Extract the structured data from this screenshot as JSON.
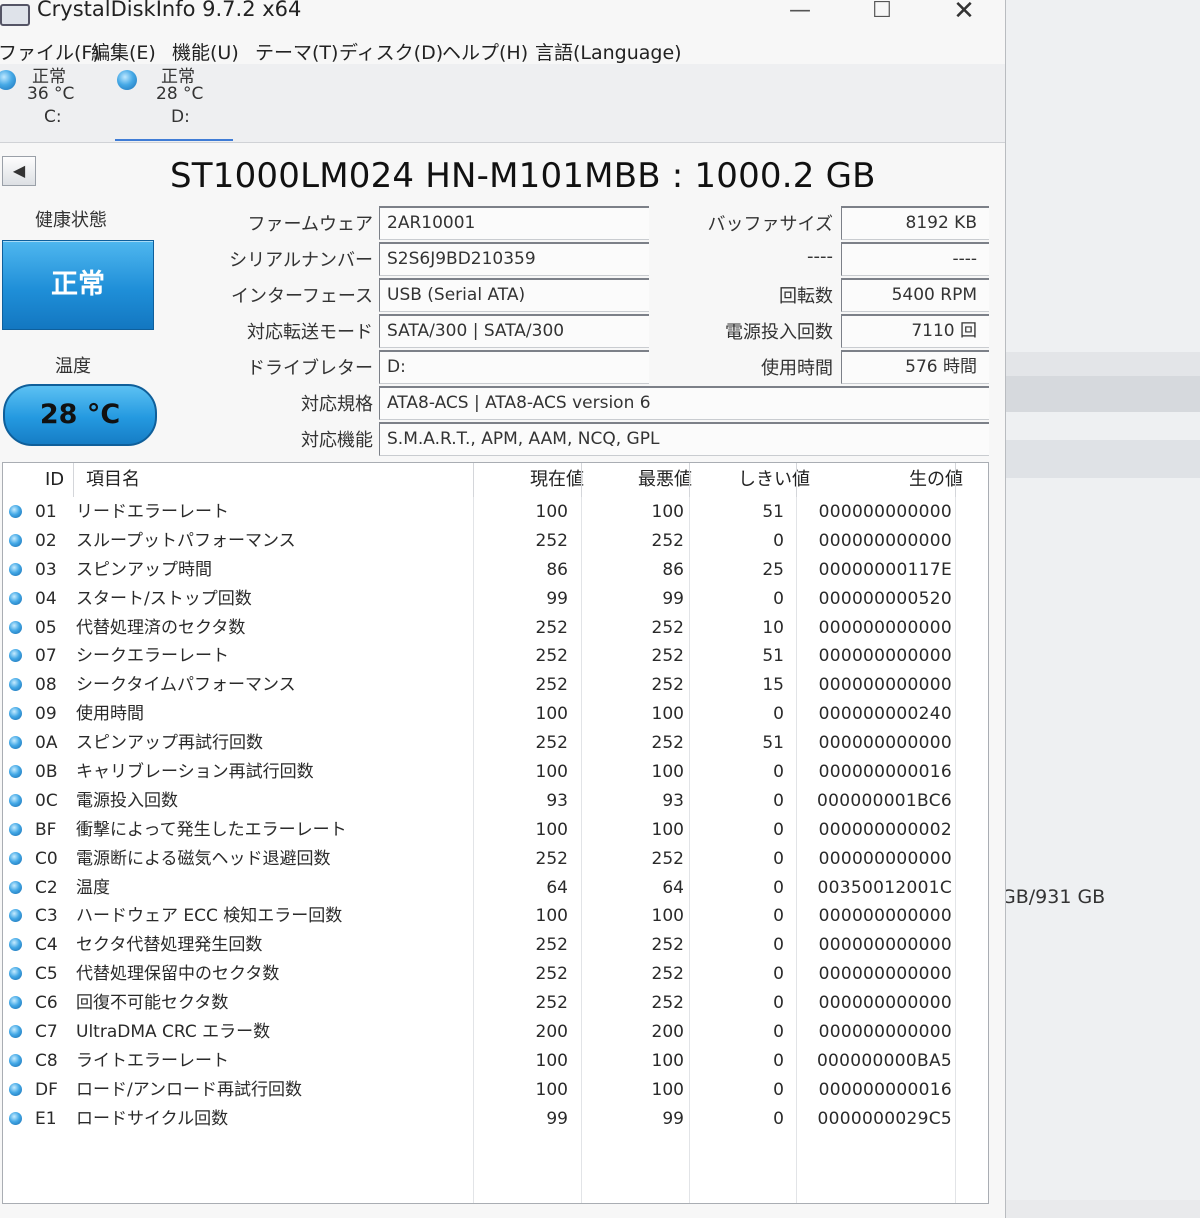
{
  "window": {
    "title": "CrystalDiskInfo 9.7.2 x64",
    "minimize": "—",
    "maximize": "☐",
    "close": "✕"
  },
  "menu": [
    "ファイル(F)",
    "編集(E)",
    "機能(U)",
    "テーマ(T)",
    "ディスク(D)",
    "ヘルプ(H)",
    "言語(Language)"
  ],
  "drives": [
    {
      "status": "正常",
      "temp": "36 °C",
      "letter": "C:"
    },
    {
      "status": "正常",
      "temp": "28 °C",
      "letter": "D:"
    }
  ],
  "disk": {
    "model": "ST1000LM024 HN-M101MBB : 1000.2 GB",
    "health_label": "健康状態",
    "health_value": "正常",
    "temp_label": "温度",
    "temp_value": "28 °C",
    "firmware_label": "ファームウェア",
    "firmware": "2AR10001",
    "serial_label": "シリアルナンバー",
    "serial": "S2S6J9BD210359",
    "interface_label": "インターフェース",
    "interface": "USB (Serial ATA)",
    "transfer_label": "対応転送モード",
    "transfer": "SATA/300 | SATA/300",
    "letter_label": "ドライブレター",
    "letter": "D:",
    "standard_label": "対応規格",
    "standard": "ATA8-ACS | ATA8-ACS version 6",
    "features_label": "対応機能",
    "features": "S.M.A.R.T., APM, AAM, NCQ, GPL",
    "buffer_label": "バッファサイズ",
    "buffer": "8192 KB",
    "blank_label": "----",
    "blank_value": "----",
    "rpm_label": "回転数",
    "rpm": "5400 RPM",
    "power_count_label": "電源投入回数",
    "power_count": "7110 回",
    "hours_label": "使用時間",
    "hours": "576 時間"
  },
  "background": {
    "volume": "GB/931 GB"
  },
  "table": {
    "headers": {
      "id": "ID",
      "name": "項目名",
      "current": "現在値",
      "worst": "最悪値",
      "threshold": "しきい値",
      "raw": "生の値"
    },
    "rows": [
      {
        "id": "01",
        "name": "リードエラーレート",
        "current": "100",
        "worst": "100",
        "threshold": "51",
        "raw": "000000000000"
      },
      {
        "id": "02",
        "name": "スループットパフォーマンス",
        "current": "252",
        "worst": "252",
        "threshold": "0",
        "raw": "000000000000"
      },
      {
        "id": "03",
        "name": "スピンアップ時間",
        "current": "86",
        "worst": "86",
        "threshold": "25",
        "raw": "00000000117E"
      },
      {
        "id": "04",
        "name": "スタート/ストップ回数",
        "current": "99",
        "worst": "99",
        "threshold": "0",
        "raw": "000000000520"
      },
      {
        "id": "05",
        "name": "代替処理済のセクタ数",
        "current": "252",
        "worst": "252",
        "threshold": "10",
        "raw": "000000000000"
      },
      {
        "id": "07",
        "name": "シークエラーレート",
        "current": "252",
        "worst": "252",
        "threshold": "51",
        "raw": "000000000000"
      },
      {
        "id": "08",
        "name": "シークタイムパフォーマンス",
        "current": "252",
        "worst": "252",
        "threshold": "15",
        "raw": "000000000000"
      },
      {
        "id": "09",
        "name": "使用時間",
        "current": "100",
        "worst": "100",
        "threshold": "0",
        "raw": "000000000240"
      },
      {
        "id": "0A",
        "name": "スピンアップ再試行回数",
        "current": "252",
        "worst": "252",
        "threshold": "51",
        "raw": "000000000000"
      },
      {
        "id": "0B",
        "name": "キャリブレーション再試行回数",
        "current": "100",
        "worst": "100",
        "threshold": "0",
        "raw": "000000000016"
      },
      {
        "id": "0C",
        "name": "電源投入回数",
        "current": "93",
        "worst": "93",
        "threshold": "0",
        "raw": "000000001BC6"
      },
      {
        "id": "BF",
        "name": "衝撃によって発生したエラーレート",
        "current": "100",
        "worst": "100",
        "threshold": "0",
        "raw": "000000000002"
      },
      {
        "id": "C0",
        "name": "電源断による磁気ヘッド退避回数",
        "current": "252",
        "worst": "252",
        "threshold": "0",
        "raw": "000000000000"
      },
      {
        "id": "C2",
        "name": "温度",
        "current": "64",
        "worst": "64",
        "threshold": "0",
        "raw": "00350012001C"
      },
      {
        "id": "C3",
        "name": "ハードウェア ECC 検知エラー回数",
        "current": "100",
        "worst": "100",
        "threshold": "0",
        "raw": "000000000000"
      },
      {
        "id": "C4",
        "name": "セクタ代替処理発生回数",
        "current": "252",
        "worst": "252",
        "threshold": "0",
        "raw": "000000000000"
      },
      {
        "id": "C5",
        "name": "代替処理保留中のセクタ数",
        "current": "252",
        "worst": "252",
        "threshold": "0",
        "raw": "000000000000"
      },
      {
        "id": "C6",
        "name": "回復不可能セクタ数",
        "current": "252",
        "worst": "252",
        "threshold": "0",
        "raw": "000000000000"
      },
      {
        "id": "C7",
        "name": "UltraDMA CRC エラー数",
        "current": "200",
        "worst": "200",
        "threshold": "0",
        "raw": "000000000000"
      },
      {
        "id": "C8",
        "name": "ライトエラーレート",
        "current": "100",
        "worst": "100",
        "threshold": "0",
        "raw": "000000000BA5"
      },
      {
        "id": "DF",
        "name": "ロード/アンロード再試行回数",
        "current": "100",
        "worst": "100",
        "threshold": "0",
        "raw": "000000000016"
      },
      {
        "id": "E1",
        "name": "ロードサイクル回数",
        "current": "99",
        "worst": "99",
        "threshold": "0",
        "raw": "0000000029C5"
      }
    ]
  }
}
